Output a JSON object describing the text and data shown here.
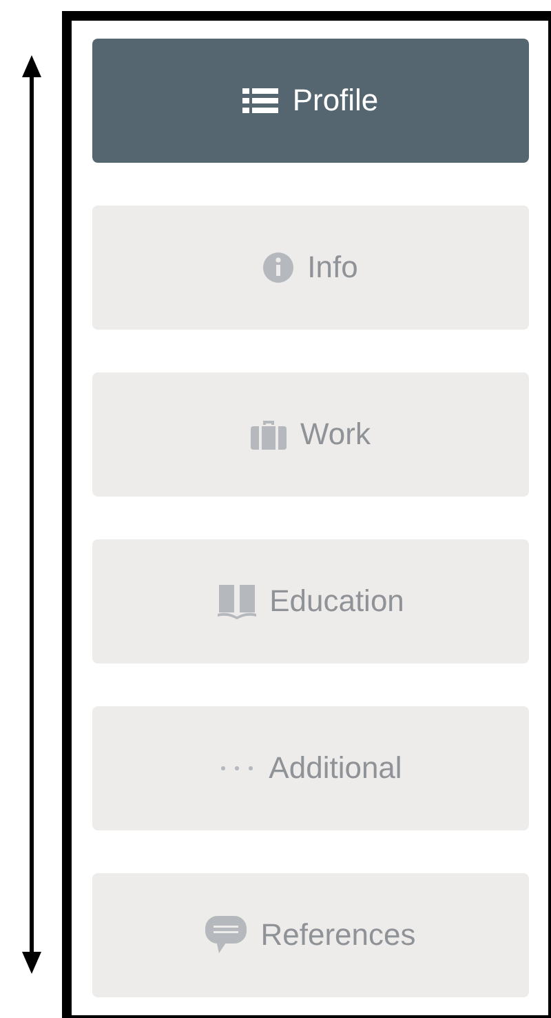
{
  "nav": {
    "items": [
      {
        "label": "Profile",
        "selected": true
      },
      {
        "label": "Info",
        "selected": false
      },
      {
        "label": "Work",
        "selected": false
      },
      {
        "label": "Education",
        "selected": false
      },
      {
        "label": "Additional",
        "selected": false
      },
      {
        "label": "References",
        "selected": false
      }
    ]
  }
}
